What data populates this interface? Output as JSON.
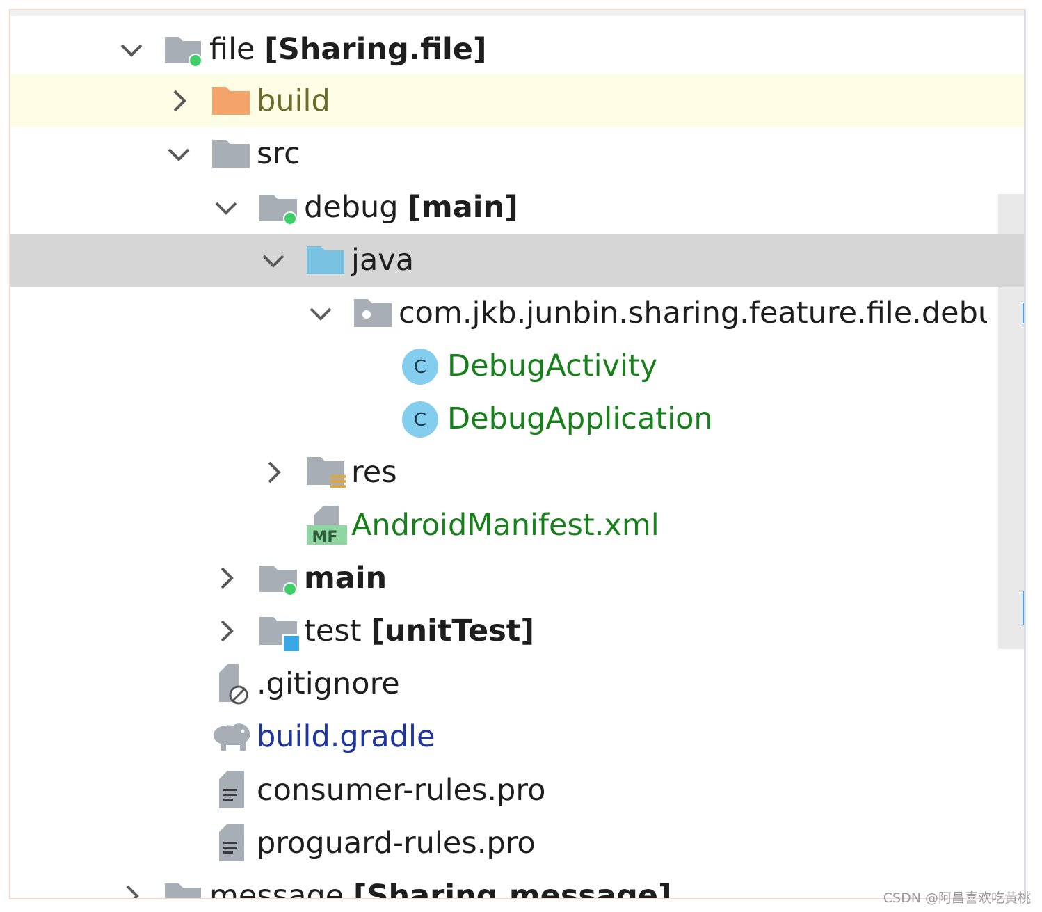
{
  "tree": {
    "items": [
      {
        "name": "file",
        "label": "file",
        "bold_suffix": "[Sharing.file]"
      },
      {
        "name": "build-folder",
        "label": "build"
      },
      {
        "name": "src",
        "label": "src"
      },
      {
        "name": "debug",
        "label": "debug",
        "bold_suffix": "[main]"
      },
      {
        "name": "java",
        "label": "java"
      },
      {
        "name": "package",
        "label": "com.jkb.junbin.sharing.feature.file.debu"
      },
      {
        "name": "debug-activity",
        "label": "DebugActivity"
      },
      {
        "name": "debug-application",
        "label": "DebugApplication"
      },
      {
        "name": "res",
        "label": "res"
      },
      {
        "name": "android-manifest",
        "label": "AndroidManifest.xml",
        "icon_badge": "MF"
      },
      {
        "name": "main",
        "label": "main"
      },
      {
        "name": "test",
        "label": "test",
        "bold_suffix": "[unitTest]"
      },
      {
        "name": "gitignore",
        "label": ".gitignore"
      },
      {
        "name": "build-gradle",
        "label": "build.gradle"
      },
      {
        "name": "consumer-rules",
        "label": "consumer-rules.pro"
      },
      {
        "name": "proguard-rules",
        "label": "proguard-rules.pro"
      },
      {
        "name": "message",
        "label": "message",
        "bold_suffix": "[Sharing.message]"
      }
    ],
    "class_icon_letter": "C"
  },
  "watermark": "CSDN @阿昌喜欢吃黄桃",
  "colors": {
    "folder_gray": "#a7aeb6",
    "build_folder": "#f4a36a",
    "java_folder": "#79c2e2",
    "module_dot": "#3fcf68",
    "class_icon": "#83cdee",
    "green_text": "#17801b",
    "blue_text": "#1f35a0"
  }
}
